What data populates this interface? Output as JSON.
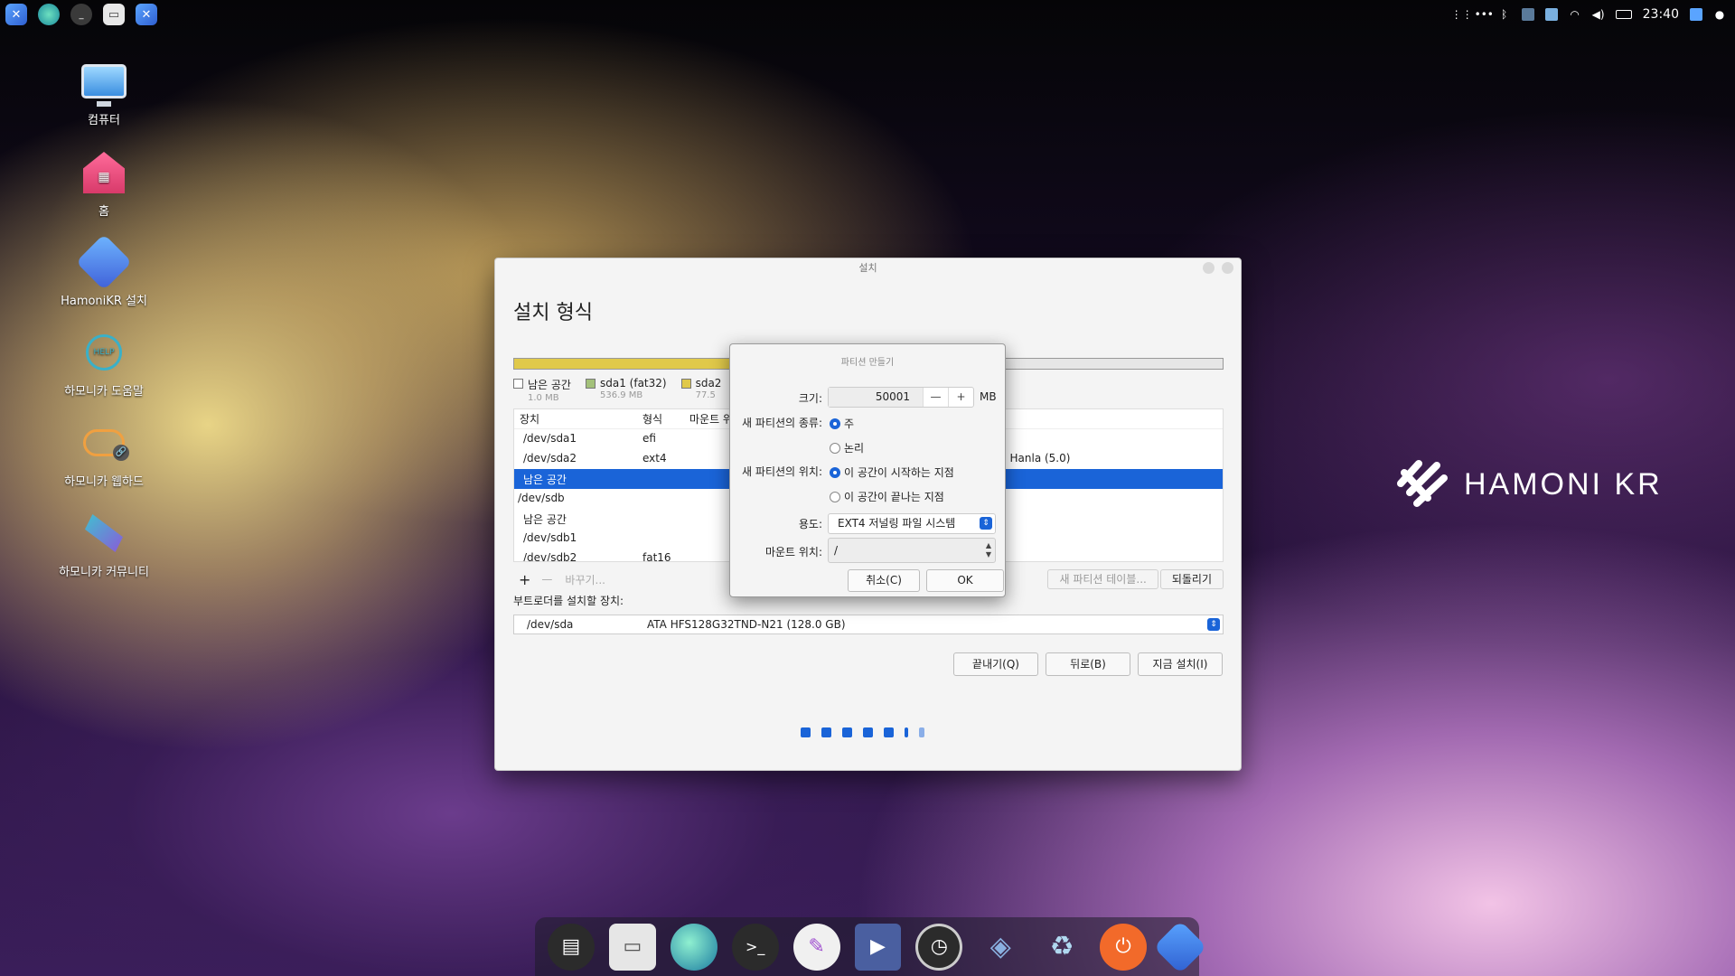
{
  "topbar": {
    "clock": "23:40",
    "left_icons": [
      "hamonikr-icon",
      "browser-icon",
      "terminal-icon",
      "files-icon",
      "installer-icon"
    ],
    "right_icons": [
      "apps-grid-icon",
      "more-icon",
      "bluetooth-icon",
      "monitor-icon",
      "mail-icon",
      "wifi-icon",
      "volume-icon",
      "battery-icon",
      "display-icon",
      "user-icon"
    ]
  },
  "desktop": {
    "computer": "컴퓨터",
    "home": "홈",
    "installer": "HamoniKR 설치",
    "help": "하모니카 도움말",
    "webhard": "하모니카 웹하드",
    "community": "하모니카 커뮤니티"
  },
  "brand": "HAMONI KR",
  "window": {
    "title": "설치",
    "heading": "설치 형식",
    "legend": [
      {
        "label": "남은 공간",
        "size": "1.0 MB",
        "color": "#ffffff"
      },
      {
        "label": "sda1 (fat32)",
        "size": "536.9 MB",
        "color": "#a3c17a"
      },
      {
        "label": "sda2",
        "size": "77.5",
        "color": "#e0c94a"
      }
    ],
    "table": {
      "headers": [
        "장치",
        "형식",
        "마운트 위"
      ],
      "rows": [
        {
          "device": "/dev/sda1",
          "type": "efi",
          "extra": ""
        },
        {
          "device": "/dev/sda2",
          "type": "ext4",
          "extra": ") Hanla (5.0)"
        },
        {
          "device": "남은 공간",
          "type": "",
          "extra": ""
        },
        {
          "device": "/dev/sdb",
          "type": "",
          "extra": ""
        },
        {
          "device": "남은 공간",
          "type": "",
          "extra": ""
        },
        {
          "device": "/dev/sdb1",
          "type": "",
          "extra": ""
        },
        {
          "device": "/dev/sdb2",
          "type": "fat16",
          "extra": ""
        }
      ]
    },
    "tools": {
      "add": "+",
      "remove": "—",
      "change": "바꾸기...",
      "new_table": "새 파티션 테이블...",
      "revert": "되돌리기"
    },
    "bootloader_label": "부트로더를 설치할 장치:",
    "bootloader_device": "/dev/sda",
    "bootloader_desc": "ATA HFS128G32TND-N21 (128.0 GB)",
    "buttons": {
      "quit": "끝내기(Q)",
      "back": "뒤로(B)",
      "install": "지금 설치(I)"
    }
  },
  "dialog": {
    "title": "파티션 만들기",
    "size_label": "크기:",
    "size_value": "50001",
    "size_unit": "MB",
    "type_label": "새 파티션의 종류:",
    "type_primary": "주",
    "type_logical": "논리",
    "location_label": "새 파티션의 위치:",
    "location_start": "이 공간이 시작하는 지점",
    "location_end": "이 공간이 끝나는 지점",
    "use_label": "용도:",
    "use_value": "EXT4 저널링 파일 시스템",
    "mount_label": "마운트 위치:",
    "mount_value": "/",
    "cancel": "취소(C)",
    "ok": "OK"
  },
  "dock": [
    "screenshot-app",
    "files",
    "browser",
    "terminal",
    "text-editor",
    "video-editor",
    "system-monitor",
    "package-manager",
    "trash",
    "power",
    "hamonikr"
  ]
}
